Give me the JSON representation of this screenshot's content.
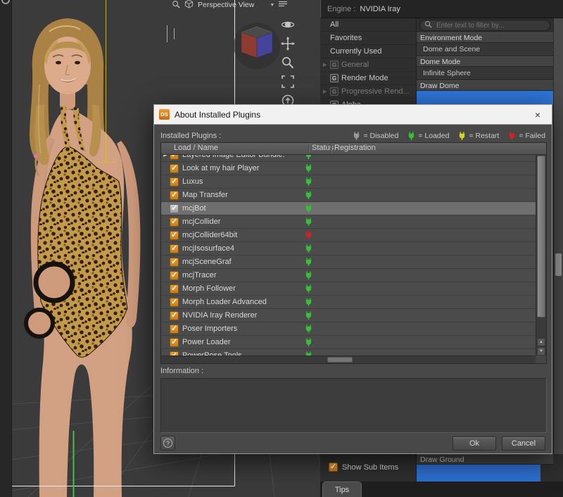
{
  "viewport": {
    "view_selector_label": "Perspective View"
  },
  "render_panel": {
    "engine_label": "Engine :",
    "engine_value": "NVIDIA Iray",
    "items": [
      {
        "label": "All",
        "cls": "plain"
      },
      {
        "label": "Favorites",
        "cls": "plain"
      },
      {
        "label": "Currently Used",
        "cls": "plain"
      },
      {
        "label": "General",
        "icon": "G",
        "cls": "group dim"
      },
      {
        "label": "Render Mode",
        "icon": "G",
        "cls": "leaf"
      },
      {
        "label": "Progressive Rend...",
        "icon": "G",
        "cls": "group dim"
      },
      {
        "label": "Alpha",
        "icon": "G",
        "cls": "leaf"
      }
    ]
  },
  "settings_panel": {
    "filter_placeholder": "Enter text to filter by...",
    "environment_mode_label": "Environment Mode",
    "environment_mode_value": "Dome and Scene",
    "dome_mode_label": "Dome Mode",
    "dome_mode_value": "Infinite Sphere",
    "draw_dome_label": "Draw Dome",
    "dome_color": "#2e74d8",
    "draw_ground_label": "Draw Ground",
    "ground_color": "#2e6fd0",
    "show_sub_items_label": "Show Sub Items",
    "tips_tab_label": "Tips"
  },
  "dialog": {
    "ds_icon_text": "DS",
    "title": "About Installed Plugins",
    "close_label": "×",
    "installed_plugins_label": "Installed Plugins :",
    "legend": [
      {
        "label": "= Disabled",
        "color": "#9a9a9a"
      },
      {
        "label": "= Loaded",
        "color": "#35c135"
      },
      {
        "label": "= Restart",
        "color": "#d6d21e"
      },
      {
        "label": "= Failed",
        "color": "#d42222"
      }
    ],
    "columns": {
      "name": "Load / Name",
      "status": "Status",
      "registration": "Registration"
    },
    "rows": [
      {
        "name": "Layered Image Editor Bundle:",
        "status": "loaded",
        "cls": "expandable"
      },
      {
        "name": "Look at my hair Player",
        "status": "loaded"
      },
      {
        "name": "Luxus",
        "status": "loaded"
      },
      {
        "name": "Map Transfer",
        "status": "loaded"
      },
      {
        "name": "mcjBot",
        "status": "loaded",
        "cls": "selected"
      },
      {
        "name": "mcjCollider",
        "status": "loaded"
      },
      {
        "name": "mcjCollider64bit",
        "status": "failed"
      },
      {
        "name": "mcjIsosurface4",
        "status": "loaded"
      },
      {
        "name": "mcjSceneGraf",
        "status": "loaded"
      },
      {
        "name": "mcjTracer",
        "status": "loaded"
      },
      {
        "name": "Morph Follower",
        "status": "loaded"
      },
      {
        "name": "Morph Loader Advanced",
        "status": "loaded"
      },
      {
        "name": "NVIDIA Iray Renderer",
        "status": "loaded"
      },
      {
        "name": "Poser Importers",
        "status": "loaded"
      },
      {
        "name": "Power Loader",
        "status": "loaded"
      },
      {
        "name": "PowerPose Tools",
        "status": "loaded"
      }
    ],
    "information_label": "Information :",
    "information_text": "",
    "help_label": "?",
    "ok_label": "Ok",
    "cancel_label": "Cancel"
  }
}
